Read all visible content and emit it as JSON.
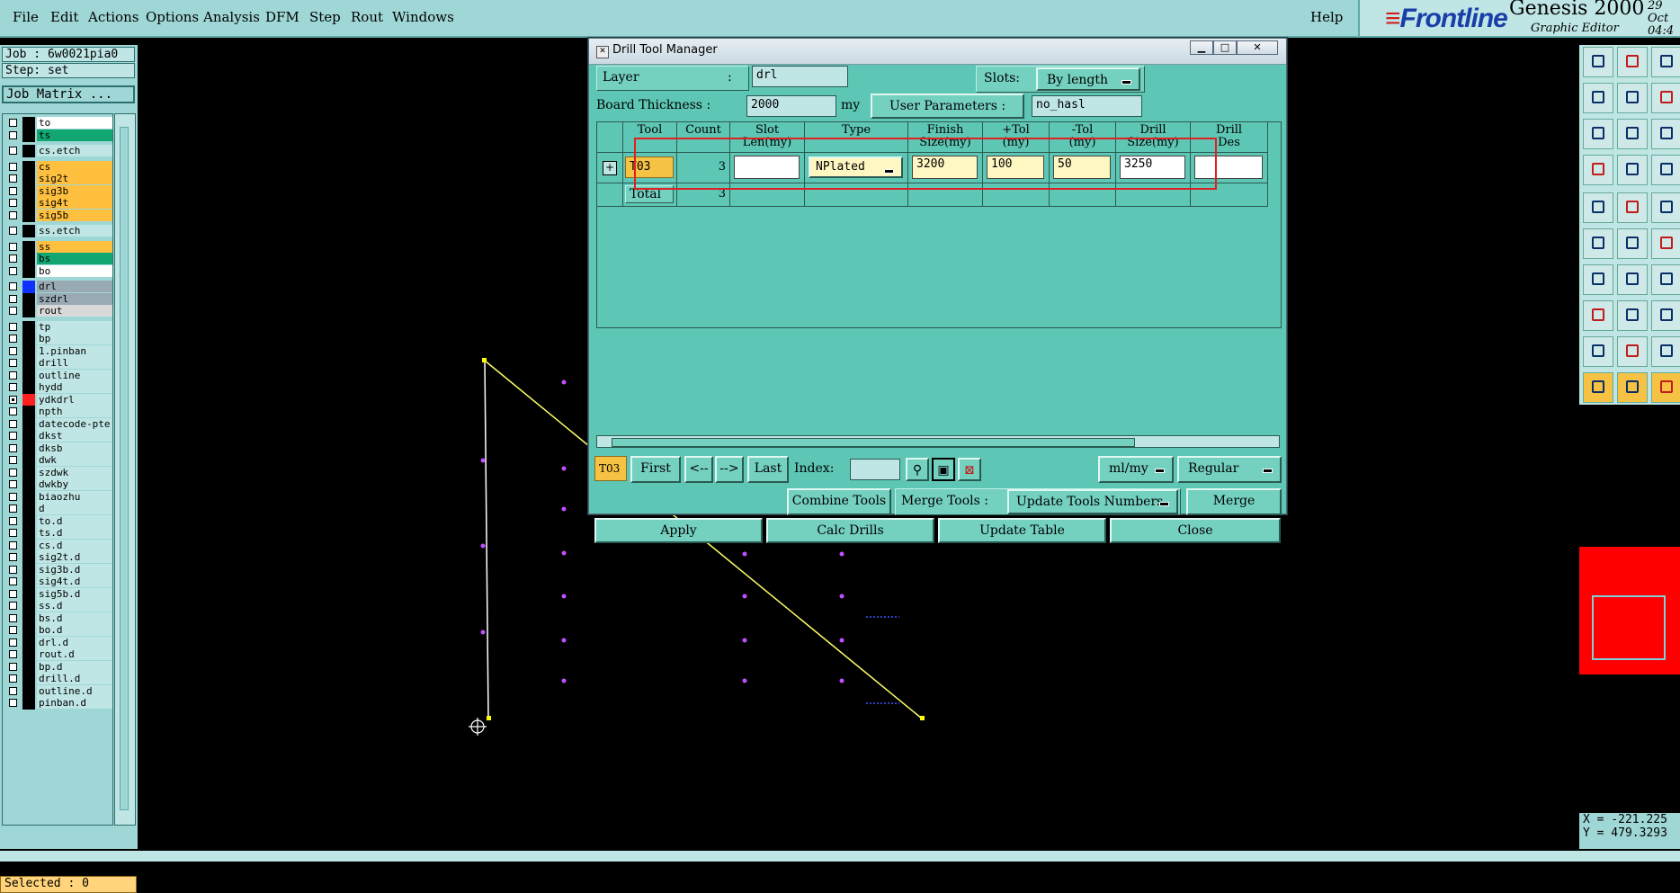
{
  "menubar": {
    "items": [
      "File",
      "Edit",
      "Actions",
      "Options",
      "Analysis",
      "DFM",
      "Step",
      "Rout",
      "Windows"
    ],
    "help": "Help"
  },
  "logo": {
    "brand": "Frontline",
    "product": "Genesis 2000",
    "subtitle": "Graphic Editor",
    "date_top": "29 Oct",
    "date_bottom": "04:4"
  },
  "job": {
    "job_line": "Job : 6w0021pia0",
    "step_line": "Step: set",
    "matrix_button": "Job Matrix ..."
  },
  "layers": [
    {
      "name": "to",
      "color": "#ffffff",
      "checked": false
    },
    {
      "name": "ts",
      "color": "#12a673",
      "checked": false
    },
    {
      "name": "cs.etch",
      "color": "#bfe6e5",
      "checked": false
    },
    {
      "name": "cs",
      "color": "#ffbf3f",
      "checked": false
    },
    {
      "name": "sig2t",
      "color": "#ffbf3f",
      "checked": false
    },
    {
      "name": "sig3b",
      "color": "#ffbf3f",
      "checked": false
    },
    {
      "name": "sig4t",
      "color": "#ffbf3f",
      "checked": false
    },
    {
      "name": "sig5b",
      "color": "#ffbf3f",
      "checked": false
    },
    {
      "name": "ss.etch",
      "color": "#bfe6e5",
      "checked": false
    },
    {
      "name": "ss",
      "color": "#ffbf3f",
      "checked": false
    },
    {
      "name": "bs",
      "color": "#12a673",
      "checked": false
    },
    {
      "name": "bo",
      "color": "#ffffff",
      "checked": false
    },
    {
      "name": "drl",
      "color": "#99aab4",
      "checked": false,
      "swatch": "#1030ff"
    },
    {
      "name": "szdrl",
      "color": "#99aab4",
      "checked": false
    },
    {
      "name": "rout",
      "color": "#d9d9d9",
      "checked": false
    },
    {
      "name": "tp",
      "color": "#bfe6e5",
      "checked": false
    },
    {
      "name": "bp",
      "color": "#bfe6e5",
      "checked": false
    },
    {
      "name": "1.pinban",
      "color": "#bfe6e5",
      "checked": false
    },
    {
      "name": "drill",
      "color": "#bfe6e5",
      "checked": false
    },
    {
      "name": "outline",
      "color": "#bfe6e5",
      "checked": false
    },
    {
      "name": "hydd",
      "color": "#bfe6e5",
      "checked": false
    },
    {
      "name": "ydkdrl",
      "color": "#bfe6e5",
      "checked": true,
      "swatch": "#ff2020"
    },
    {
      "name": "npth",
      "color": "#bfe6e5",
      "checked": false
    },
    {
      "name": "datecode-pte",
      "color": "#bfe6e5",
      "checked": false
    },
    {
      "name": "dkst",
      "color": "#bfe6e5",
      "checked": false
    },
    {
      "name": "dksb",
      "color": "#bfe6e5",
      "checked": false
    },
    {
      "name": "dwk",
      "color": "#bfe6e5",
      "checked": false
    },
    {
      "name": "szdwk",
      "color": "#bfe6e5",
      "checked": false
    },
    {
      "name": "dwkby",
      "color": "#bfe6e5",
      "checked": false
    },
    {
      "name": "biaozhu",
      "color": "#bfe6e5",
      "checked": false
    },
    {
      "name": "d",
      "color": "#bfe6e5",
      "checked": false
    },
    {
      "name": "to.d",
      "color": "#bfe6e5",
      "checked": false
    },
    {
      "name": "ts.d",
      "color": "#bfe6e5",
      "checked": false
    },
    {
      "name": "cs.d",
      "color": "#bfe6e5",
      "checked": false
    },
    {
      "name": "sig2t.d",
      "color": "#bfe6e5",
      "checked": false
    },
    {
      "name": "sig3b.d",
      "color": "#bfe6e5",
      "checked": false
    },
    {
      "name": "sig4t.d",
      "color": "#bfe6e5",
      "checked": false
    },
    {
      "name": "sig5b.d",
      "color": "#bfe6e5",
      "checked": false
    },
    {
      "name": "ss.d",
      "color": "#bfe6e5",
      "checked": false
    },
    {
      "name": "bs.d",
      "color": "#bfe6e5",
      "checked": false
    },
    {
      "name": "bo.d",
      "color": "#bfe6e5",
      "checked": false
    },
    {
      "name": "drl.d",
      "color": "#bfe6e5",
      "checked": false
    },
    {
      "name": "rout.d",
      "color": "#bfe6e5",
      "checked": false
    },
    {
      "name": "bp.d",
      "color": "#bfe6e5",
      "checked": false
    },
    {
      "name": "drill.d",
      "color": "#bfe6e5",
      "checked": false
    },
    {
      "name": "outline.d",
      "color": "#bfe6e5",
      "checked": false
    },
    {
      "name": "pinban.d",
      "color": "#bfe6e5",
      "checked": false
    }
  ],
  "status": {
    "selected": "Selected : 0"
  },
  "coords": {
    "x": "X = -221.225",
    "y": "Y = 479.3293"
  },
  "dialog": {
    "title": "Drill Tool Manager",
    "layer_label": "Layer",
    "layer_colon": ":",
    "layer_value": "drl",
    "slots_label": "Slots:",
    "slots_value": "By length",
    "thickness_label": "Board Thickness :",
    "thickness_value": "2000",
    "thickness_unit": "my",
    "user_params_label": "User Parameters :",
    "user_params_value": "no_hasl",
    "table": {
      "headers": [
        {
          "top": "Tool",
          "bottom": ""
        },
        {
          "top": "Count",
          "bottom": ""
        },
        {
          "top": "Slot",
          "bottom": "Len(my)"
        },
        {
          "top": "Type",
          "bottom": ""
        },
        {
          "top": "Finish",
          "bottom": "Size(my)"
        },
        {
          "top": "+Tol",
          "bottom": "(my)"
        },
        {
          "top": "-Tol",
          "bottom": "(my)"
        },
        {
          "top": "Drill",
          "bottom": "Size(my)"
        },
        {
          "top": "Drill",
          "bottom": "Des"
        }
      ],
      "row": {
        "tool": "T03",
        "count": "3",
        "slot_len": "",
        "type": "NPlated",
        "finish_size": "3200",
        "plus_tol": "100",
        "minus_tol": "50",
        "drill_size": "3250",
        "drill_des": ""
      },
      "total_label": "Total",
      "total_count": "3"
    },
    "nav": {
      "current_tool": "T03",
      "first": "First",
      "prev": "<--",
      "next": "-->",
      "last": "Last",
      "index_label": "Index:",
      "index_value": "",
      "units": "ml/my",
      "mode": "Regular"
    },
    "actions": {
      "combine": "Combine Tools",
      "merge_label": "Merge Tools :",
      "update_numbers": "Update Tools Numbers",
      "merge": "Merge",
      "apply": "Apply",
      "calc": "Calc Drills",
      "update_table": "Update Table",
      "close": "Close"
    }
  }
}
